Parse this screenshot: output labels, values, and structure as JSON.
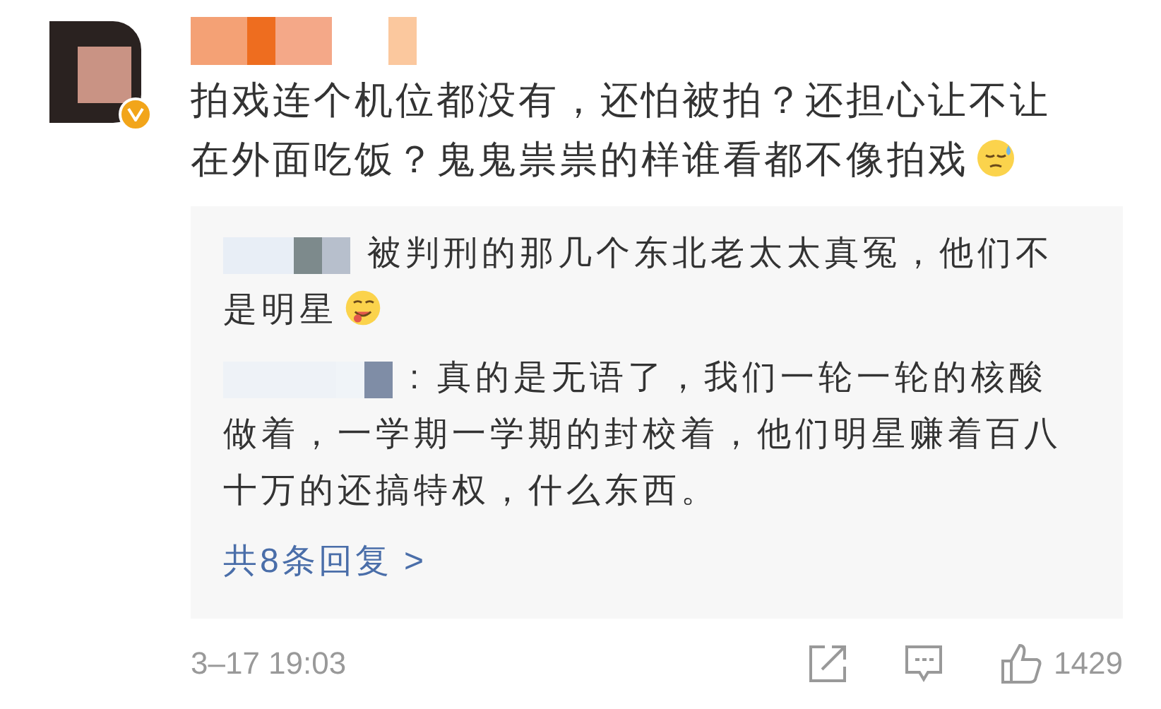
{
  "comment": {
    "verified": true,
    "text": "拍戏连个机位都没有，还怕被拍？还担心让不让在外面吃饭？鬼鬼祟祟的样谁看都不像拍戏"
  },
  "replies": [
    {
      "text": "被判刑的那几个东北老太太真冤，他们不是明星"
    },
    {
      "text": ": 真的是无语了，我们一轮一轮的核酸做着，一学期一学期的封校着，他们明星赚着百八十万的还搞特权，什么东西。"
    }
  ],
  "more_replies": "共8条回复 >",
  "footer": {
    "time": "3–17 19:03",
    "likes": "1429"
  }
}
